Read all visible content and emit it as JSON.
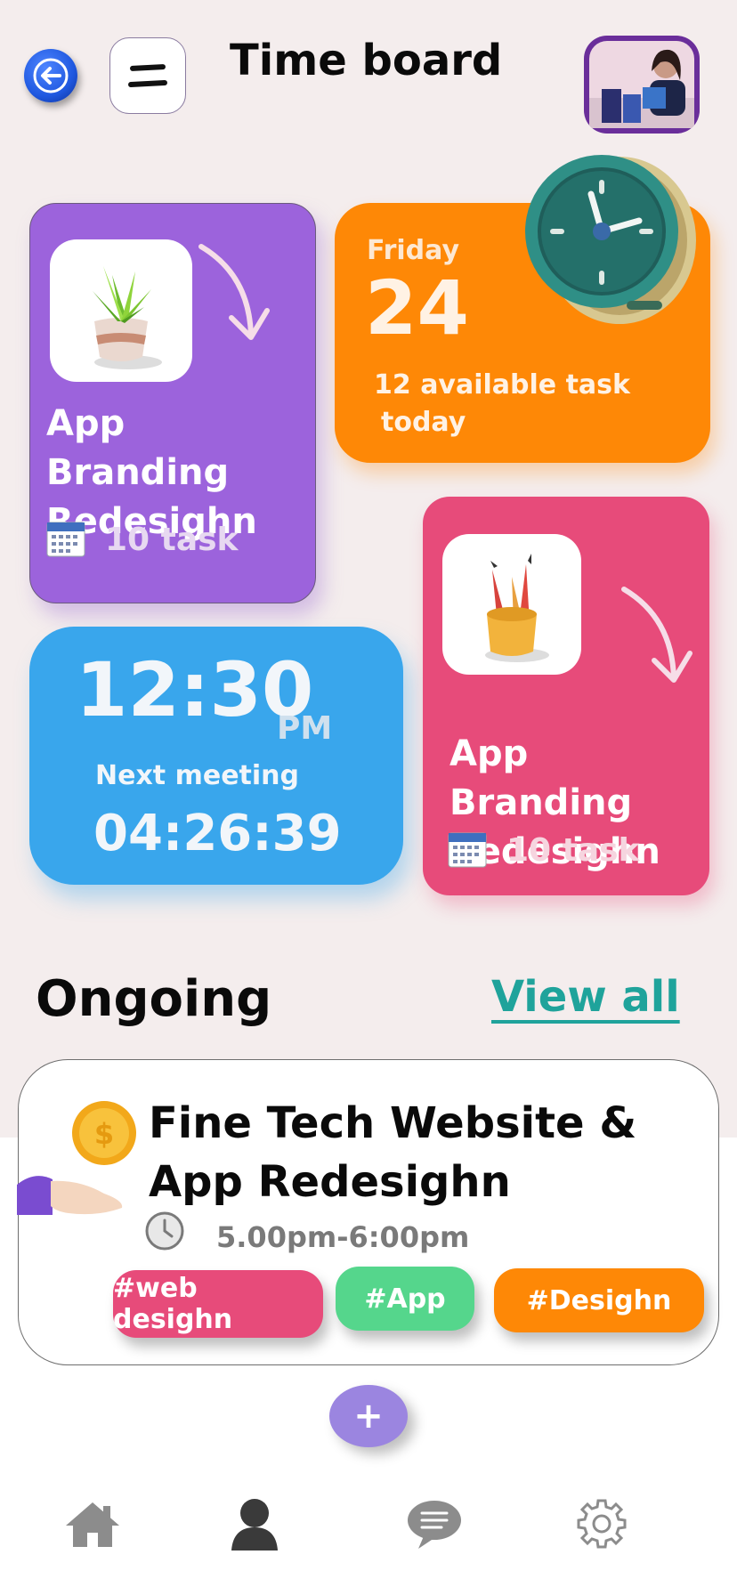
{
  "header": {
    "title": "Time board",
    "back_icon": "back-arrow-icon",
    "menu_icon": "menu-icon"
  },
  "cards": {
    "branding_purple": {
      "title_line1": "App Branding",
      "title_line2": "Redesighn",
      "tasks": "10 task",
      "color": "#9c63dc"
    },
    "date": {
      "day": "Friday",
      "date": "24",
      "available_line1": "12 available task",
      "available_line2": "today",
      "color": "#fe8806"
    },
    "time": {
      "time": "12:30",
      "ampm": "PM",
      "next_label": "Next meeting",
      "countdown": "04:26:39",
      "color": "#39a6ec"
    },
    "branding_pink": {
      "title_line1": "App Branding",
      "title_line2": "Redesighn",
      "tasks": "10 task",
      "color": "#e74b7a"
    }
  },
  "ongoing": {
    "title": "Ongoing",
    "view_all": "View all",
    "card": {
      "name": "Fine Tech Website & App Redesighn",
      "time": "5.00pm-6:00pm",
      "tags": [
        {
          "label": "#web desighn",
          "color": "#e74b7a"
        },
        {
          "label": "#App",
          "color": "#55d68c"
        },
        {
          "label": "#Desighn",
          "color": "#fe8806"
        }
      ]
    }
  },
  "add_button": "+",
  "nav": {
    "items": [
      "home-icon",
      "profile-icon",
      "chat-icon",
      "settings-icon"
    ]
  }
}
